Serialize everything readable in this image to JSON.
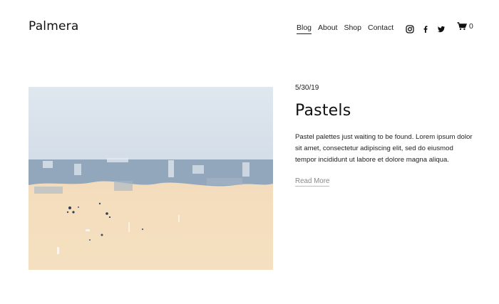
{
  "site": {
    "logo": "Palmera"
  },
  "nav": {
    "items": [
      {
        "label": "Blog",
        "active": true
      },
      {
        "label": "About",
        "active": false
      },
      {
        "label": "Shop",
        "active": false
      },
      {
        "label": "Contact",
        "active": false
      }
    ]
  },
  "social": {
    "icons": [
      "instagram-icon",
      "facebook-icon",
      "twitter-icon"
    ]
  },
  "cart": {
    "icon": "cart-icon",
    "count": "0"
  },
  "post": {
    "date": "5/30/19",
    "title": "Pastels",
    "excerpt": "Pastel palettes just waiting to be found. Lorem ipsum dolor sit amet, consectetur adipiscing elit, sed do eiusmod tempor incididunt ut labore et dolore magna aliqua.",
    "read_more": "Read More"
  },
  "colors": {
    "sky": "#dde6ee",
    "blue_band": "#8fa3b8",
    "sand": "#f4dec0",
    "text": "#111111",
    "muted": "#888888"
  }
}
